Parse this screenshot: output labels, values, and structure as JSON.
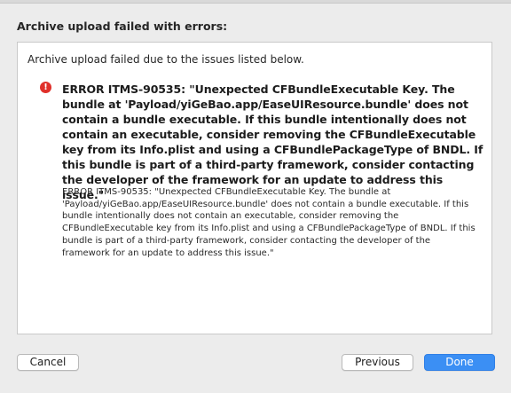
{
  "dialog": {
    "title": "Archive upload failed with errors:",
    "intro": "Archive upload failed due to the issues listed below.",
    "error": {
      "icon": "error-icon",
      "icon_color": "#e0302a",
      "icon_glyph": "!",
      "summary": "ERROR ITMS-90535: \"Unexpected CFBundleExecutable Key. The bundle at 'Payload/yiGeBao.app/EaseUIResource.bundle' does not contain a bundle executable. If this bundle intentionally does not contain an executable, consider removing the CFBundleExecutable key from its Info.plist and using a CFBundlePackageType of BNDL. If this bundle is part of a third-party framework, consider contacting the developer of the framework for an update to address this issue.\"",
      "detail": "ERROR ITMS-90535: \"Unexpected CFBundleExecutable Key. The bundle at 'Payload/yiGeBao.app/EaseUIResource.bundle' does not contain a bundle executable. If this bundle intentionally does not contain an executable, consider removing the CFBundleExecutable key from its Info.plist and using a CFBundlePackageType of BNDL. If this bundle is part of a third-party framework, consider contacting the developer of the framework for an update to address this issue.\""
    }
  },
  "buttons": {
    "cancel": "Cancel",
    "previous": "Previous",
    "done": "Done"
  },
  "colors": {
    "accent": "#3b8ff4",
    "error": "#e0302a"
  }
}
